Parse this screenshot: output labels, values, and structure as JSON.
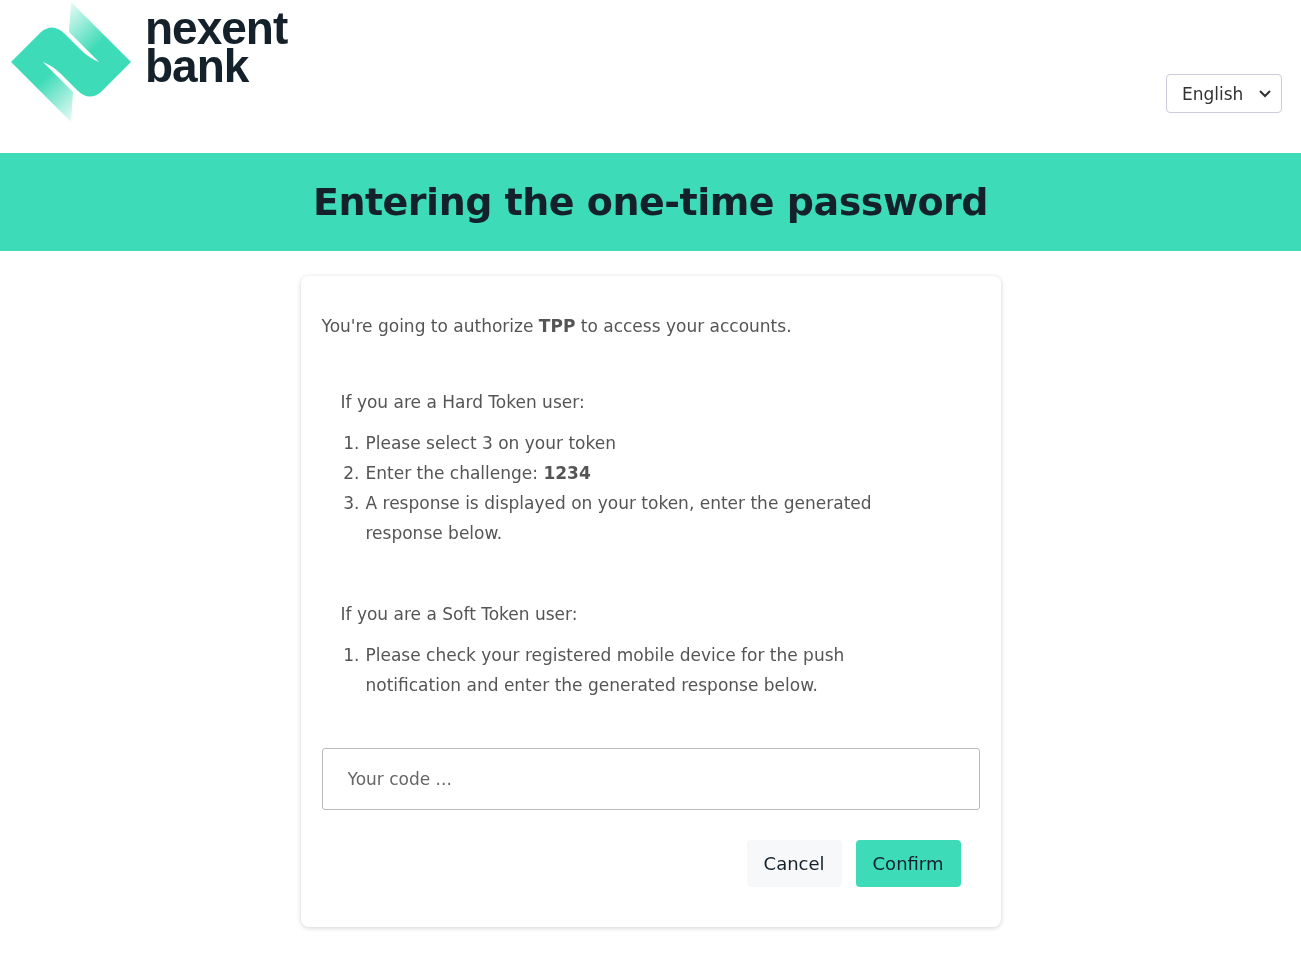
{
  "logo": {
    "line_1": "nexent",
    "line_2": "bank"
  },
  "language_select": {
    "value": "English"
  },
  "banner": {
    "title": "Entering the one-time password"
  },
  "intro": "You're going to authorize **TPP** to access your accounts.",
  "sections": [
    {
      "heading": "If you are a Hard Token user:",
      "steps": [
        {
          "number": "1.",
          "text": "Please select 3 on your token"
        },
        {
          "number": "2.",
          "text": "Enter the challenge: **1234**"
        },
        {
          "number": "3.",
          "text": "A response is displayed on your token, enter the generated response below."
        }
      ]
    },
    {
      "heading": "If you are a Soft Token user:",
      "steps": [
        {
          "number": "1.",
          "text": "Please check your registered mobile device for the push notification and enter the generated response below."
        }
      ]
    }
  ],
  "code_field": {
    "placeholder": "Your code ..."
  },
  "buttons": [
    {
      "kind": "secondary",
      "label": "Cancel"
    },
    {
      "kind": "primary",
      "label": "Confirm"
    }
  ]
}
